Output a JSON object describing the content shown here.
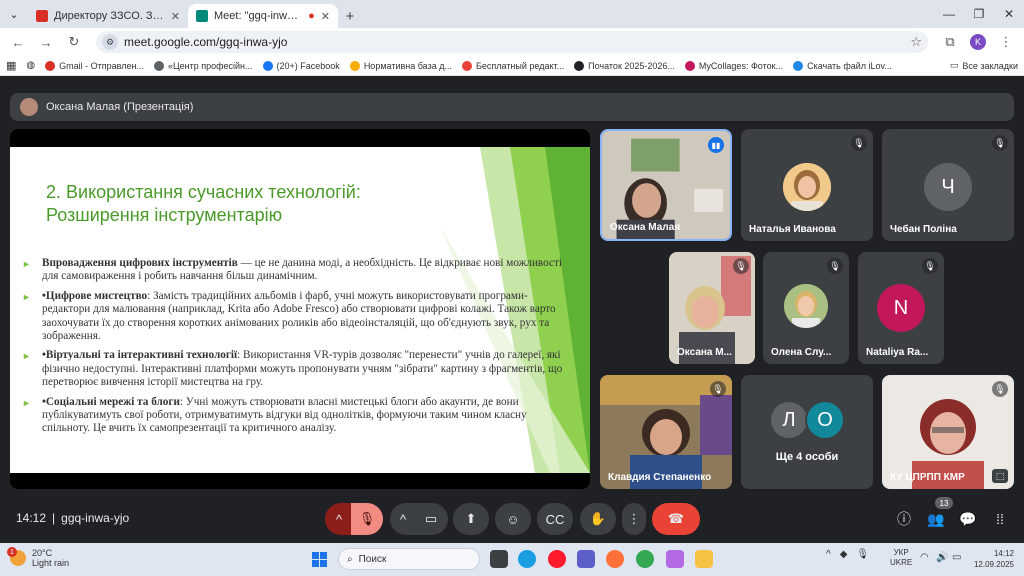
{
  "browser": {
    "tabs": [
      {
        "title": "Директору ЗЗСО. Запрошення",
        "active": false,
        "favicon_color": "#d93025"
      },
      {
        "title": "Meet: \"ggq-inwa-yjo\"",
        "active": true,
        "favicon_color": "#00897b"
      }
    ],
    "url": "meet.google.com/ggq-inwa-yjo",
    "profile_initial": "K",
    "bookmarks": [
      {
        "label": "Gmail - Отправлен...",
        "color": "#d93025"
      },
      {
        "label": "«Центр професійн...",
        "color": "#5f6368"
      },
      {
        "label": "(20+) Facebook",
        "color": "#1877f2"
      },
      {
        "label": "Нормативна база д...",
        "color": "#f9ab00"
      },
      {
        "label": "Бесплатный редакт...",
        "color": "#ea4335"
      },
      {
        "label": "Початок 2025-2026...",
        "color": "#202124"
      },
      {
        "label": "MyCollages: Фоток...",
        "color": "#c2185b"
      },
      {
        "label": "Скачать файл iLov...",
        "color": "#1e88e5"
      }
    ],
    "all_bookmarks": "Все закладки"
  },
  "meet": {
    "presenter_label": "Оксана Малая (Презентація)",
    "slide": {
      "title_line1": "2. Використання сучасних технологій:",
      "title_line2": "Розширення інструментарію",
      "bullets": [
        {
          "bold": "Впровадження цифрових інструментів",
          "text": " — це не данина моді, а необхідність. Це відкриває нові можливості для самовираження і робить навчання більш динамічним."
        },
        {
          "bold": "•Цифрове мистецтво",
          "text": ": Замість традиційних альбомів і фарб, учні можуть використовувати програми-редактори для малювання (наприклад, Krita або Adobe Fresco) або створювати цифрові колажі. Також варто заохочувати їх до створення коротких анімованих роликів або відеоінсталяцій, що об'єднують звук, рух та зображення."
        },
        {
          "bold": "•Віртуальні та інтерактивні технології",
          "text": ": Використання VR-турів дозволяє \"перенести\" учнів до галереї, які фізично недоступні. Інтерактивні платформи можуть пропонувати учням \"зібрати\" картину з фрагментів, що перетворює вивчення історії мистецтва на гру."
        },
        {
          "bold": "•Соціальні мережі та блоги",
          "text": ": Учні можуть створювати власні мистецькі блоги або акаунти, де вони публікуватимуть свої роботи, отримуватимуть відгуки від однолітків, формуючи таким чином класну спільноту. Це вчить їх самопрезентації та критичного аналізу."
        }
      ]
    },
    "participants": [
      {
        "name": "Оксана Малая",
        "speaking": true,
        "type": "video"
      },
      {
        "name": "Наталья Иванова",
        "muted": true,
        "type": "photo"
      },
      {
        "name": "Чебан Поліна",
        "muted": true,
        "type": "initial",
        "initial": "Ч",
        "color": "#5f6368"
      },
      {
        "name": "Оксана М...",
        "muted": true,
        "type": "video"
      },
      {
        "name": "Олена Слу...",
        "muted": true,
        "type": "photo"
      },
      {
        "name": "Nataliya Ra...",
        "muted": true,
        "type": "initial",
        "initial": "N",
        "color": "#c2185b"
      },
      {
        "name": "Клавдия Степаненко",
        "muted": true,
        "type": "video"
      },
      {
        "name": "Ще 4 особи",
        "type": "group",
        "initials": [
          "Л",
          "О"
        ]
      },
      {
        "name": "КУ ЦПРПП КМР",
        "muted": true,
        "type": "video"
      }
    ],
    "time": "14:12",
    "meeting_code": "ggq-inwa-yjo",
    "participant_count": "13"
  },
  "taskbar": {
    "temperature": "20°C",
    "weather": "Light rain",
    "weather_badge": "1",
    "search_placeholder": "Поиск",
    "lang_line1": "УКР",
    "lang_line2": "UKRE",
    "clock_time": "14:12",
    "clock_date": "12.09.2025"
  }
}
